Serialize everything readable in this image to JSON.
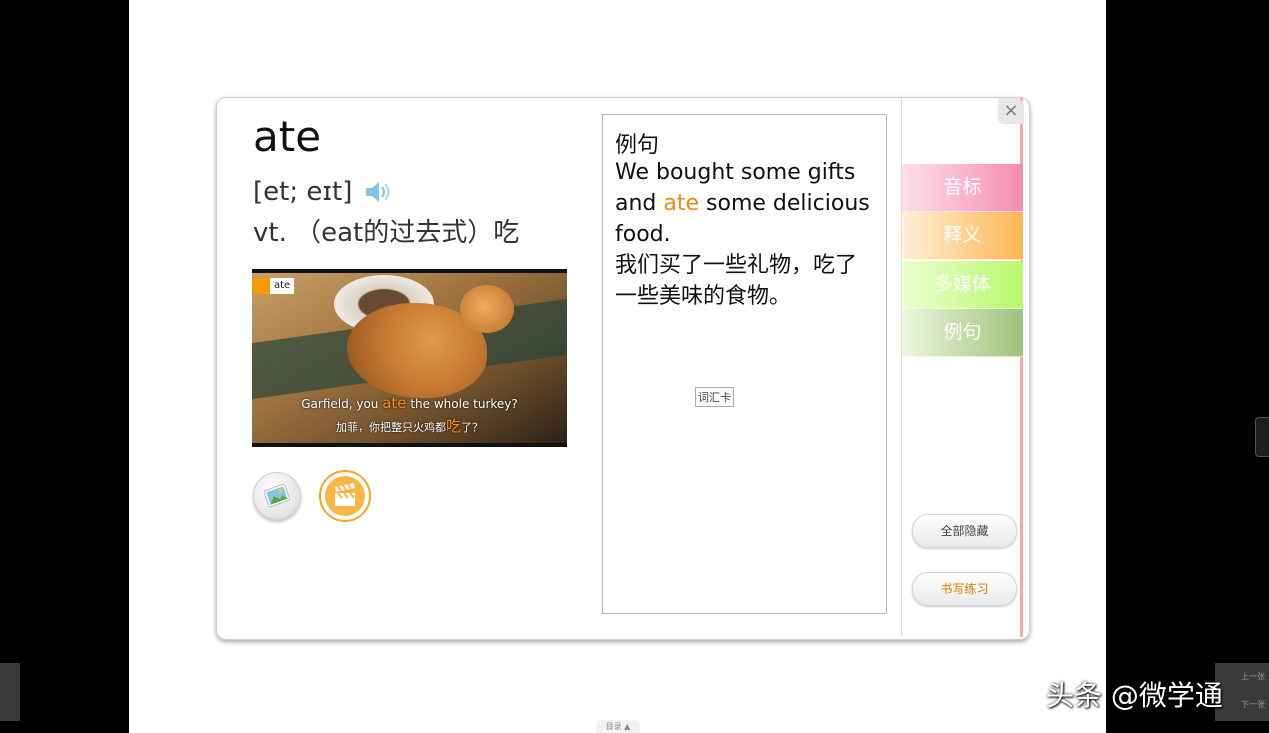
{
  "card": {
    "word": "ate",
    "phonetic": "[et; eɪt]",
    "definition": "vt. （eat的过去式）吃"
  },
  "video": {
    "tag": "ate",
    "subtitle_en_before": "Garfield, you ",
    "subtitle_en_highlight": "ate",
    "subtitle_en_after": " the whole turkey?",
    "subtitle_zh_before": "加菲，你把整只火鸡都",
    "subtitle_zh_highlight": "吃",
    "subtitle_zh_after": "了？"
  },
  "example": {
    "title": "例句",
    "en_before": "We bought some gifts and ",
    "en_highlight": "ate",
    "en_after": " some delicious food.",
    "zh": "我们买了一些礼物，吃了一些美味的食物。",
    "vocab_card_label": "词汇卡"
  },
  "sidebar": {
    "close_symbol": "×",
    "tabs": [
      {
        "label": "音标",
        "color": "#f48db2"
      },
      {
        "label": "释义",
        "color": "#fdb552"
      },
      {
        "label": "多媒体",
        "color": "#b8f76b"
      },
      {
        "label": "例句",
        "color": "#9ec37a"
      }
    ],
    "hide_all_label": "全部隐藏",
    "writing_practice_label": "书写练习"
  },
  "nav": {
    "prev_label": "上一张",
    "next_label": "下一张",
    "toc_label": "目录 ▲"
  },
  "watermark": "头条 @微学通",
  "colors": {
    "highlight": "#f08a14"
  }
}
